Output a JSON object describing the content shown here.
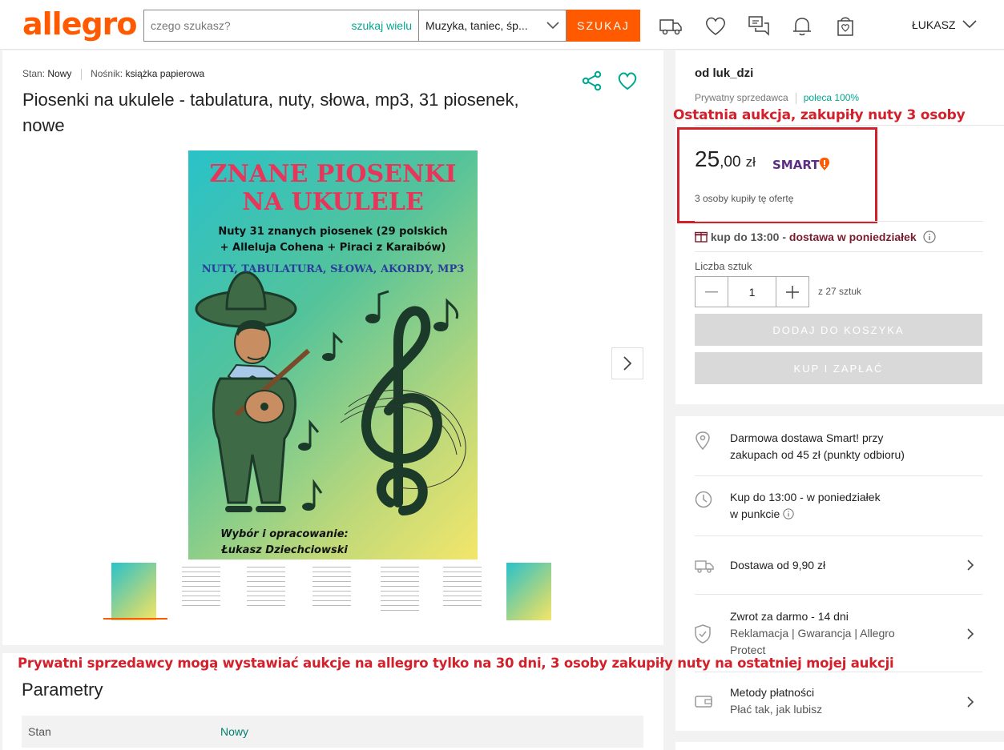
{
  "header": {
    "logo": "allegro",
    "search_placeholder": "czego szukasz?",
    "search_multi": "szukaj wielu",
    "category": "Muzyka, taniec, śp...",
    "search_button": "SZUKAJ",
    "user": "ŁUKASZ"
  },
  "product": {
    "stan_label": "Stan:",
    "stan_value": "Nowy",
    "nosnik_label": "Nośnik:",
    "nosnik_value": "książka papierowa",
    "title": "Piosenki na ukulele - tabulatura, nuty, słowa, mp3, 31 piosenek, nowe",
    "cover": {
      "line1": "ZNANE PIOSENKI",
      "line2": "NA UKULELE",
      "sub1": "Nuty 31 znanych piosenek (29 polskich",
      "sub2": "+ Alleluja Cohena + Piraci z Karaibów)",
      "sub3": "NUTY, TABULATURA, SŁOWA, AKORDY, MP3",
      "author1": "Wybór i opracowanie:",
      "author2": "Łukasz Dziechciowski"
    }
  },
  "annotations": {
    "top": "Ostatnia aukcja, zakupiły nuty 3 osoby",
    "bottom": "Prywatni sprzedawcy mogą wystawiać aukcje na allegro tylko na 30 dni, 3 osoby zakupiły nuty na ostatniej mojej aukcji"
  },
  "params": {
    "title": "Parametry",
    "rows": [
      {
        "key": "Stan",
        "value": "Nowy"
      }
    ]
  },
  "seller": {
    "name": "od luk_dzi",
    "type": "Prywatny sprzedawca",
    "recommend": "poleca 100%"
  },
  "offer": {
    "price_int": "25",
    "price_dec": ",00",
    "currency": "zł",
    "smart": "SMART",
    "bought": "3 osoby kupiły tę ofertę",
    "deliv_a": "kup do 13:00 -",
    "deliv_b": "dostawa w poniedziałek",
    "qty_label": "Liczba sztuk",
    "qty_value": "1",
    "qty_of": "z 27 sztuk",
    "add_to_cart": "DODAJ DO KOSZYKA",
    "buy_now": "KUP I ZAPŁAĆ"
  },
  "info": {
    "row1_a": "Darmowa dostawa Smart! przy",
    "row1_b": "zakupach od 45 zł (punkty odbioru)",
    "row2_a": "Kup do 13:00 - w poniedziałek",
    "row2_b": "w punkcie",
    "row3": "Dostawa od 9,90 zł",
    "row4_a": "Zwrot za darmo - 14 dni",
    "row4_b": "Reklamacja | Gwarancja | Allegro",
    "row4_c": "Protect",
    "row5_a": "Metody płatności",
    "row5_b": "Płać tak, jak lubisz"
  },
  "colors": {
    "brand": "#ff5a00",
    "accent": "#00a790",
    "annotation": "#d4202a"
  }
}
